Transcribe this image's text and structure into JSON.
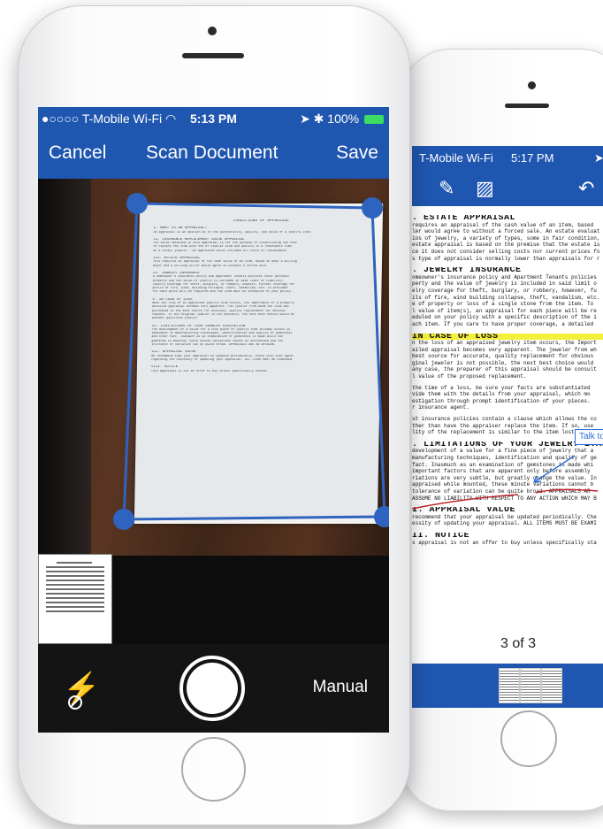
{
  "back_phone": {
    "status_bar": {
      "carrier": "T-Mobile Wi-Fi",
      "wifi_icon": "◠",
      "time": "5:17 PM",
      "location_icon": "➤"
    },
    "toolbar": {
      "pen_icon": "✎",
      "image_icon": "▨",
      "undo_icon": "↶"
    },
    "document": {
      "sections": [
        {
          "heading": ". ESTATE APPRAISAL",
          "lines": [
            "requires an appraisal of the cash value of an item, based",
            "ler would agree to without a forced sale. An estate evaluat",
            "ios of jewelry, a variety of types, some in fair condition,",
            "estate appraisal is based on the premise that the estate is",
            "ce it does not consider selling costs nor current prices fo",
            "s type of appraisal is normally lower than appraisals for r"
          ]
        },
        {
          "heading": ". JEWELRY INSURANCE",
          "lines": [
            "omeowner's insurance policy and Apartment Tenants policies",
            "perty and the value of jewelry is included in said limit o",
            "elry coverage for theft, burglary, or robbery, however, fu",
            "ils of fire, wind building collapse, theft, vandalism, etc.",
            "e of property or loss of a single stone from the item. To",
            "l value of item(s), an appraisal for each piece will be re",
            "eduled on your policy with a specific description of the i",
            "ach item. If you care to have proper coverage, a detailed"
          ]
        },
        {
          "heading": " IN CASE OF LOSS",
          "lines": [
            "n the loss of an appraised jewelry item occurs, the Import",
            "ailed appraisal becomes very apparent. The jeweler from wh",
            "best source for accurate, quality replacement for obvious",
            "ginal jeweler is not possible, the next best choice would",
            "any case, the preparer of this appraisal should be consult",
            "l value of the proposed replacement.",
            "",
            "the time of a loss, be sure your facts are substantiated",
            "vide them with the details from your appraisal, which mo",
            "estigation through prompt identification of your pieces.",
            "r insurance agent.",
            "",
            "st insurance policies contain a clause which allows the co",
            "ther than have the appraiser replace the item. If so, use",
            "lity of the replacement is similar to the item lost."
          ]
        },
        {
          "heading": ". LIMITATIONS OF YOUR JEWELRY EVAL",
          "lines": [
            "development of a value for a fine piece of jewelry that a",
            "manufacturing techniques, identification and quality of ge",
            "fact. Inasmuch as an examination of gemstones is made whi",
            "important factors that are apparent only before assembly",
            "riations are very subtle, but greatly change the value. In",
            "appraised while mounted, these minute variations cannot b",
            "tolerance of variation can be quite broad. APPRAISALS AR",
            "ASSUME NO LIABILITY WITH RESPECT TO ANY ACTION WHICH MAY B"
          ]
        },
        {
          "heading": "I. APPRAISAL VALUE",
          "lines": [
            "recommend that your appraisal be updated periodically. Che",
            "essity of updating your appraisal. ALL ITEMS MUST BE EXAMI"
          ]
        },
        {
          "heading": "II. NOTICE",
          "lines": []
        },
        {
          "heading": "",
          "lines": [
            "s appraisal is not an offer to buy unless specifically sta"
          ]
        }
      ]
    },
    "comment_label": "Talk to",
    "page_indicator": "3 of 3"
  },
  "front_phone": {
    "status_bar": {
      "carrier": "●○○○○ T-Mobile Wi-Fi ◠",
      "time": "5:13 PM",
      "right": "➤ ✱ 100%"
    },
    "nav": {
      "cancel_label": "Cancel",
      "title": "Scan Document",
      "save_label": "Save"
    },
    "paper": {
      "title": "CONDITIONS OF APPRAISAL",
      "sections": [
        {
          "heading": "I.   WHAT IS AN APPRAISAL?",
          "lines": [
            "An appraisal is an opinion as to the authenticity, quality, and value of a jewelry item."
          ]
        },
        {
          "heading": "II.  INSURANCE REPLACEMENT VALUE APPRAISAL",
          "lines": [
            "The value obtained in this appraisal is for the purpose of establishing the cost",
            "to replace the item with one of similar kind and quality in a reasonable time",
            "at a retail jeweler. The appraised value includes all costs of replacement."
          ]
        },
        {
          "heading": "III. ESTATE APPRAISAL",
          "lines": [
            "This requires an appraisal of the cash value of an item, based on what a willing",
            "buyer and a willing seller would agree to without a forced sale."
          ]
        },
        {
          "heading": "IV.  JEWELRY INSURANCE",
          "lines": [
            "A homeowner's insurance policy and Apartment Tenants policies cover personal",
            "property and the value of jewelry is included in said limit of liability.",
            "Jewelry coverage for theft, burglary, or robbery, however, further coverage for",
            "perils of fire, wind, building collapse, theft, vandalism, etc. is provided",
            "for each piece will be required and the item must be scheduled on your policy."
          ]
        },
        {
          "heading": "V.   IN CASE OF LOSS",
          "lines": [
            "When the loss of an appraised jewelry item occurs, the importance of a properly",
            "detailed appraisal becomes very apparent. The jeweler from whom the item was",
            "purchased is the best source for accurate, quality replacement for obvious",
            "reasons. If the original jeweler is not possible, the next best choice would be",
            "another qualified jeweler."
          ]
        },
        {
          "heading": "VI.  LIMITATIONS OF YOUR JEWELRY EVALUATION",
          "lines": [
            "The development of a value for a fine piece of jewelry that already exists is",
            "dependent on manufacturing techniques, identification and quality of gemstones",
            "and other fact. Inasmuch as an examination of gemstones is made while the",
            "gemstone is mounted, these minute variations cannot be determined and the",
            "tolerance of variation can be quite broad. APPRAISALS ARE AN OPINION."
          ]
        },
        {
          "heading": "VII. APPRAISAL VALUE",
          "lines": [
            "We recommend that your appraisal be updated periodically. Check with your agent",
            "regarding the necessity of updating your appraisal. ALL ITEMS MUST BE EXAMINED."
          ]
        },
        {
          "heading": "VIII. NOTICE",
          "lines": [
            "This appraisal is not an offer to buy unless specifically stated."
          ]
        }
      ]
    },
    "controls": {
      "flash_icon": "⚡",
      "manual_label": "Manual"
    }
  },
  "colors": {
    "accent": "#1f56b0",
    "detect_blue": "#2e64bf",
    "highlight": "#f4ef3a",
    "comment_blue": "#2d6dd8"
  }
}
